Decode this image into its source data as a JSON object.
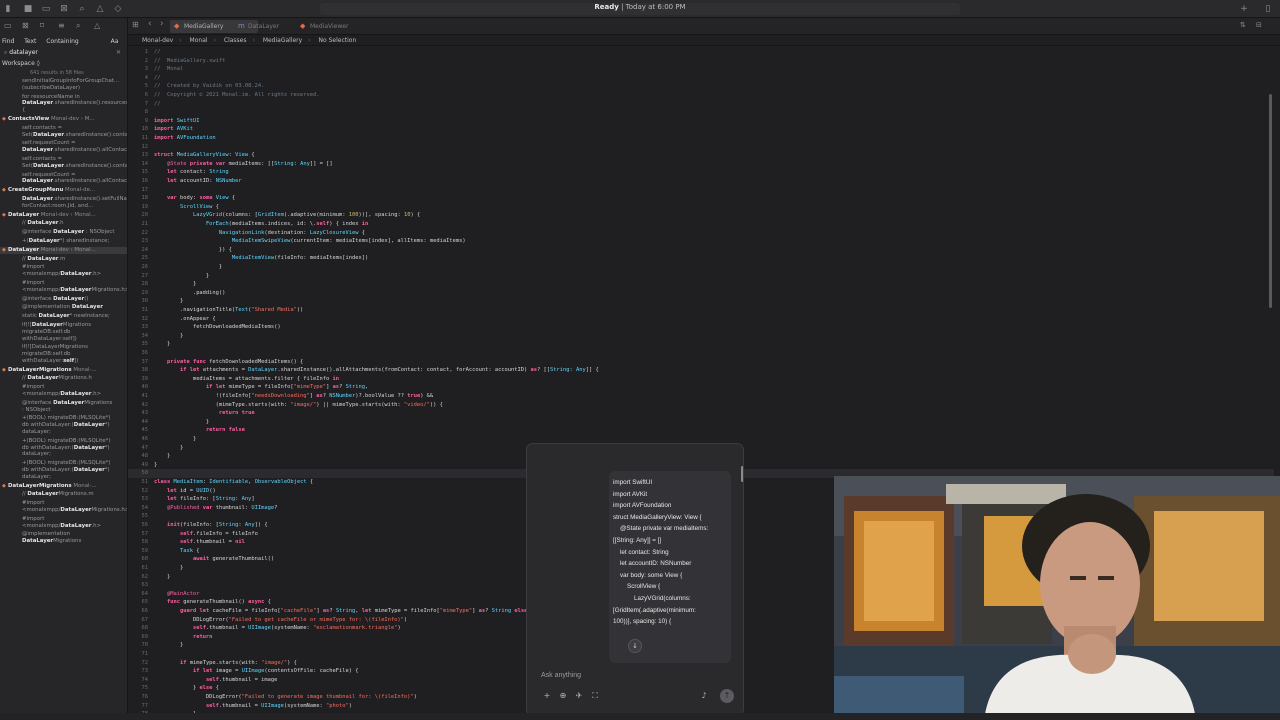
{
  "titlebar": {
    "status_bold": "Ready",
    "status_rest": " | Today at 6:00 PM"
  },
  "tabs": [
    {
      "label": "MediaGallery"
    },
    {
      "label": "DataLayer"
    },
    {
      "label": "MediaViewer"
    }
  ],
  "breadcrumb": [
    "Monal-dev",
    "Monal",
    "Classes",
    "MediaGallery",
    "No Selection"
  ],
  "navigator": {
    "filter_tabs": [
      "Find",
      "Text",
      "Containing"
    ],
    "filter_right": "Aa",
    "search_value": "datalayer",
    "scope": "Workspace",
    "result_count": "641 results in 58 files",
    "results": [
      {
        "kind": "line",
        "pre": "",
        "match": "",
        "post": "sendInitialGroupInfoForGroupChat... (subscribeDataLayer)"
      },
      {
        "kind": "line",
        "pre": "for ressourceName in ",
        "match": "DataLayer",
        "post": ".sharedInstance().resourcesFor(contact.obj) {"
      },
      {
        "kind": "group",
        "name": "ContactsView",
        "detail": " Monal-dev › M..."
      },
      {
        "kind": "line",
        "pre": "self.contacts = Set(",
        "match": "DataLayer",
        "post": ".sharedInstance().contactList())"
      },
      {
        "kind": "line",
        "pre": "self.requestCount = ",
        "match": "DataLayer",
        "post": ".sharedInstance().allContactRequests().count"
      },
      {
        "kind": "line",
        "pre": "self.contacts = Set(",
        "match": "DataLayer",
        "post": ".sharedInstance().contactList())"
      },
      {
        "kind": "line",
        "pre": "self.requestCount = ",
        "match": "DataLayer",
        "post": ".sharedInstance().allContactRequests().count"
      },
      {
        "kind": "group",
        "name": "CreateGroupMenu",
        "detail": " Monal-de..."
      },
      {
        "kind": "line",
        "pre": "",
        "match": "DataLayer",
        "post": ".sharedInstance().setFullName(self.groupName, forContact:room.Jid, and..."
      },
      {
        "kind": "group",
        "name": "DataLayer",
        "detail": " Monal-dev › Monal..."
      },
      {
        "kind": "line",
        "pre": "// ",
        "match": "DataLayer",
        "post": ".h"
      },
      {
        "kind": "line",
        "pre": "@interface ",
        "match": "DataLayer",
        "post": " : NSObject"
      },
      {
        "kind": "line",
        "pre": "+(",
        "match": "DataLayer",
        "post": "*) sharedInstance;"
      },
      {
        "kind": "group",
        "name": "DataLayer",
        "detail": " Monal-dev › Monal...",
        "selected": true
      },
      {
        "kind": "line",
        "pre": "// ",
        "match": "DataLayer",
        "post": ".m"
      },
      {
        "kind": "line",
        "pre": "#import <monalxmpp/",
        "match": "DataLayer",
        "post": ".h>"
      },
      {
        "kind": "line",
        "pre": "#import <monalxmpp/",
        "match": "DataLayer",
        "post": "Migrations.h>"
      },
      {
        "kind": "line",
        "pre": "@interface ",
        "match": "DataLayer",
        "post": "()"
      },
      {
        "kind": "line",
        "pre": "@implementation ",
        "match": "DataLayer",
        "post": ""
      },
      {
        "kind": "line",
        "pre": "static ",
        "match": "DataLayer",
        "post": "* newInstance;"
      },
      {
        "kind": "line",
        "pre": "if(![",
        "match": "DataLayer",
        "post": "Migrations migrateDB:self.db withDataLayer:self])"
      },
      {
        "kind": "line",
        "pre": "if(![DataLayerMigrations migrateDB:self.db withDataLayer:",
        "match": "self",
        "post": "])"
      },
      {
        "kind": "group",
        "name": "DataLayerMigrations",
        "detail": " Monal-..."
      },
      {
        "kind": "line",
        "pre": "// ",
        "match": "DataLayer",
        "post": "Migrations.h"
      },
      {
        "kind": "line",
        "pre": "#import <monalxmpp/",
        "match": "DataLayer",
        "post": ".h>"
      },
      {
        "kind": "line",
        "pre": "@interface ",
        "match": "DataLayer",
        "post": "Migrations : NSObject"
      },
      {
        "kind": "line",
        "pre": "+(BOOL) migrateDB:(MLSQLite*) db withDataLayer:(",
        "match": "DataLayer",
        "post": "*) dataLayer;"
      },
      {
        "kind": "line",
        "pre": "+(BOOL) migrateDB:(MLSQLite*) db withDataLayer:(",
        "match": "DataLayer",
        "post": "*) dataLayer;"
      },
      {
        "kind": "line",
        "pre": "+(BOOL) migrateDB:(MLSQLite*) db withDataLayer:(",
        "match": "DataLayer",
        "post": "*) dataLayer;"
      },
      {
        "kind": "group",
        "name": "DataLayerMigrations",
        "detail": " Monal-..."
      },
      {
        "kind": "line",
        "pre": "// ",
        "match": "DataLayer",
        "post": "Migrations.m"
      },
      {
        "kind": "line",
        "pre": "#import <monalxmpp/",
        "match": "DataLayer",
        "post": "Migrations.h>"
      },
      {
        "kind": "line",
        "pre": "#import <monalxmpp/",
        "match": "DataLayer",
        "post": ".h>"
      },
      {
        "kind": "line",
        "pre": "@implementation ",
        "match": "DataLayer",
        "post": "Migrations"
      }
    ]
  },
  "editor": {
    "lines": [
      {
        "n": "1",
        "text": "//"
      },
      {
        "n": "2",
        "text": "//  MediaGallery.swift"
      },
      {
        "n": "3",
        "text": "//  Monal"
      },
      {
        "n": "4",
        "text": "//"
      },
      {
        "n": "5",
        "text": "//  Created by Vaidik on 03.08.24."
      },
      {
        "n": "6",
        "text": "//  Copyright © 2021 Monal.im. All rights reserved."
      },
      {
        "n": "7",
        "text": "//"
      },
      {
        "n": "8",
        "text": ""
      },
      {
        "n": "9",
        "text": "import SwiftUI"
      },
      {
        "n": "10",
        "text": "import AVKit"
      },
      {
        "n": "11",
        "text": "import AVFoundation"
      },
      {
        "n": "12",
        "text": ""
      },
      {
        "n": "13",
        "text": "struct MediaGalleryView: View {"
      },
      {
        "n": "14",
        "text": "    @State private var mediaItems: [[String: Any]] = []"
      },
      {
        "n": "15",
        "text": "    let contact: String"
      },
      {
        "n": "16",
        "text": "    let accountID: NSNumber"
      },
      {
        "n": "17",
        "text": ""
      },
      {
        "n": "18",
        "text": "    var body: some View {"
      },
      {
        "n": "19",
        "text": "        ScrollView {"
      },
      {
        "n": "20",
        "text": "            LazyVGrid(columns: [GridItem(.adaptive(minimum: 100))], spacing: 10) {"
      },
      {
        "n": "21",
        "text": "                ForEach(mediaItems.indices, id: \\.self) { index in"
      },
      {
        "n": "22",
        "text": "                    NavigationLink(destination: LazyClosureView {"
      },
      {
        "n": "23",
        "text": "                        MediaItemSwipeView(currentItem: mediaItems[index], allItems: mediaItems)"
      },
      {
        "n": "24",
        "text": "                    }) {"
      },
      {
        "n": "25",
        "text": "                        MediaItemView(fileInfo: mediaItems[index])"
      },
      {
        "n": "26",
        "text": "                    }"
      },
      {
        "n": "27",
        "text": "                }"
      },
      {
        "n": "28",
        "text": "            }"
      },
      {
        "n": "29",
        "text": "            .padding()"
      },
      {
        "n": "30",
        "text": "        }"
      },
      {
        "n": "31",
        "text": "        .navigationTitle(Text(\"Shared Media\"))"
      },
      {
        "n": "32",
        "text": "        .onAppear {"
      },
      {
        "n": "33",
        "text": "            fetchDownloadedMediaItems()"
      },
      {
        "n": "34",
        "text": "        }"
      },
      {
        "n": "35",
        "text": "    }"
      },
      {
        "n": "36",
        "text": ""
      },
      {
        "n": "37",
        "text": "    private func fetchDownloadedMediaItems() {"
      },
      {
        "n": "38",
        "text": "        if let attachments = DataLayer.sharedInstance().allAttachments(fromContact: contact, forAccount: accountID) as? [[String: Any]] {"
      },
      {
        "n": "39",
        "text": "            mediaItems = attachments.filter { fileInfo in"
      },
      {
        "n": "40",
        "text": "                if let mimeType = fileInfo[\"mimeType\"] as? String,"
      },
      {
        "n": "41",
        "text": "                   !(fileInfo[\"needsDownloading\"] as? NSNumber)?.boolValue ?? true) &&"
      },
      {
        "n": "42",
        "text": "                   (mimeType.starts(with: \"image/\") || mimeType.starts(with: \"video/\")) {"
      },
      {
        "n": "43",
        "text": "                    return true"
      },
      {
        "n": "44",
        "text": "                }"
      },
      {
        "n": "45",
        "text": "                return false"
      },
      {
        "n": "46",
        "text": "            }"
      },
      {
        "n": "47",
        "text": "        }"
      },
      {
        "n": "48",
        "text": "    }"
      },
      {
        "n": "49",
        "text": "}"
      },
      {
        "n": "50",
        "text": ""
      },
      {
        "n": "51",
        "text": "class MediaItem: Identifiable, ObservableObject {"
      },
      {
        "n": "52",
        "text": "    let id = UUID()"
      },
      {
        "n": "53",
        "text": "    let fileInfo: [String: Any]"
      },
      {
        "n": "54",
        "text": "    @Published var thumbnail: UIImage?"
      },
      {
        "n": "55",
        "text": ""
      },
      {
        "n": "56",
        "text": "    init(fileInfo: [String: Any]) {"
      },
      {
        "n": "57",
        "text": "        self.fileInfo = fileInfo"
      },
      {
        "n": "58",
        "text": "        self.thumbnail = nil"
      },
      {
        "n": "59",
        "text": "        Task {"
      },
      {
        "n": "60",
        "text": "            await generateThumbnail()"
      },
      {
        "n": "61",
        "text": "        }"
      },
      {
        "n": "62",
        "text": "    }"
      },
      {
        "n": "63",
        "text": ""
      },
      {
        "n": "64",
        "text": "    @MainActor"
      },
      {
        "n": "65",
        "text": "    func generateThumbnail() async {"
      },
      {
        "n": "66",
        "text": "        guard let cacheFile = fileInfo[\"cacheFile\"] as? String, let mimeType = fileInfo[\"mimeType\"] as? String else {"
      },
      {
        "n": "67",
        "text": "            DDLogError(\"Failed to get cacheFile or mimeType for: \\(fileInfo)\")"
      },
      {
        "n": "68",
        "text": "            self.thumbnail = UIImage(systemName: \"exclamationmark.triangle\")"
      },
      {
        "n": "69",
        "text": "            return"
      },
      {
        "n": "70",
        "text": "        }"
      },
      {
        "n": "71",
        "text": ""
      },
      {
        "n": "72",
        "text": "        if mimeType.starts(with: \"image/\") {"
      },
      {
        "n": "73",
        "text": "            if let image = UIImage(contentsOfFile: cacheFile) {"
      },
      {
        "n": "74",
        "text": "                self.thumbnail = image"
      },
      {
        "n": "75",
        "text": "            } else {"
      },
      {
        "n": "76",
        "text": "                DDLogError(\"Failed to generate image thumbnail for: \\(fileInfo)\")"
      },
      {
        "n": "77",
        "text": "                self.thumbnail = UIImage(systemName: \"photo\")"
      },
      {
        "n": "78",
        "text": "            }"
      }
    ]
  },
  "chat": {
    "response_lines": [
      "import SwiftUI",
      "import AVKit",
      "import AVFoundation",
      "",
      "struct MediaGalleryView: View {",
      "    @State private var mediaItems:",
      "[[String: Any]] = []",
      "    let contact: String",
      "    let accountID: NSNumber",
      "",
      "    var body: some View {",
      "        ScrollView {",
      "            LazyVGrid(columns:",
      "[GridItem(.adaptive(minimum:",
      "100))], spacing: 10) {"
    ],
    "placeholder": "Ask anything"
  },
  "colors": {
    "keyword": "#fc5fa3",
    "type": "#5dd8ff",
    "string": "#fc6a5d",
    "comment": "#6c7986",
    "number": "#d0bf69",
    "func": "#67b7a4",
    "match_highlight": "#e4e4e4"
  }
}
